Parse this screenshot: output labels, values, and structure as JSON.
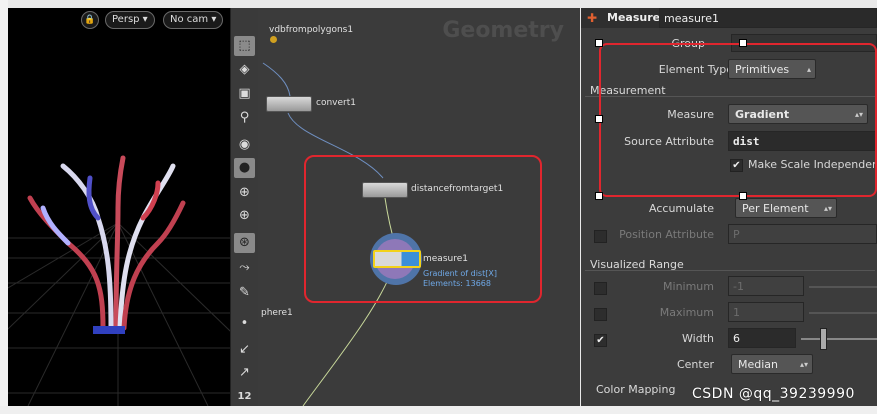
{
  "viewport": {
    "lock_icon": "lock-icon",
    "camera_mode": "Persp ▾",
    "camera_name": "No cam ▾"
  },
  "toolbar": {
    "icons": [
      "select-icon",
      "view-icon",
      "lock-icon",
      "pin-icon",
      "sphere-icon",
      "light-icon",
      "add-icon",
      "add-icon",
      "render-icon",
      "handle-icon",
      "paint-icon",
      "dot-icon",
      "brush-icon",
      "pen-icon"
    ],
    "number": "12"
  },
  "network": {
    "title": "Geometry",
    "nodes": {
      "vdb": "vdbfrompolygons1",
      "convert": "convert1",
      "distance": "distancefromtarget1",
      "measure": "measure1",
      "sphere": "phere1"
    },
    "measure_info": [
      "Gradient of dist[X]",
      "Elements: 13668"
    ]
  },
  "params": {
    "node_type": "Measure",
    "node_name": "measure1",
    "group_label": "Group",
    "element_type_label": "Element Type",
    "element_type_value": "Primitives",
    "measurement_section": "Measurement",
    "measure_label": "Measure",
    "measure_value": "Gradient",
    "source_attribute_label": "Source Attribute",
    "source_attribute_value": "dist",
    "make_scale_label": "Make Scale Independent",
    "accumulate_label": "Accumulate",
    "accumulate_value": "Per Element",
    "position_attribute_label": "Position Attribute",
    "position_attribute_value": "P",
    "visualized_range_section": "Visualized Range",
    "minimum_label": "Minimum",
    "minimum_value": "-1",
    "maximum_label": "Maximum",
    "maximum_value": "1",
    "width_label": "Width",
    "width_value": "6",
    "center_label": "Center",
    "center_value": "Median",
    "color_mapping_section": "Color Mapping"
  },
  "watermark": "CSDN @qq_39239990",
  "colors": {
    "highlight": "#e0262e",
    "info_text": "#6fa8e6"
  }
}
